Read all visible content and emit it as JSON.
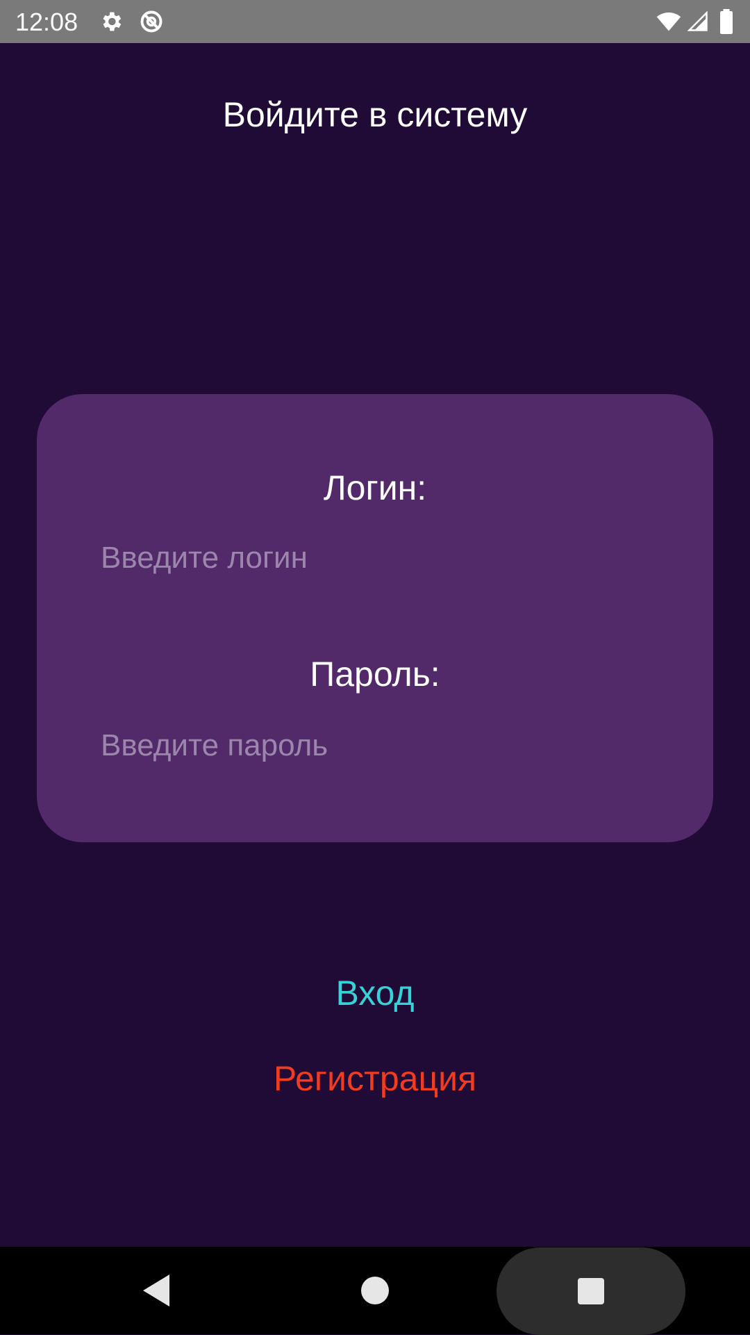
{
  "status_bar": {
    "time": "12:08",
    "icons_left": [
      "gear-icon",
      "no-sync-icon"
    ],
    "icons_right": [
      "wifi-icon",
      "signal-icon",
      "battery-icon"
    ]
  },
  "page": {
    "title": "Войдите в систему"
  },
  "form": {
    "login_label": "Логин:",
    "login_value": "",
    "login_placeholder": "Введите логин",
    "password_label": "Пароль:",
    "password_value": "",
    "password_placeholder": "Введите пароль"
  },
  "actions": {
    "login_label": "Вход",
    "register_label": "Регистрация"
  },
  "nav_bar": {
    "icons": [
      "back-icon",
      "home-icon",
      "recents-icon"
    ]
  },
  "colors": {
    "background": "#1f0b36",
    "card": "#532a69",
    "placeholder": "#9c86ad",
    "login_button": "#35d2d8",
    "register_button": "#f23b1f",
    "status_bar": "#7a7a7a"
  }
}
